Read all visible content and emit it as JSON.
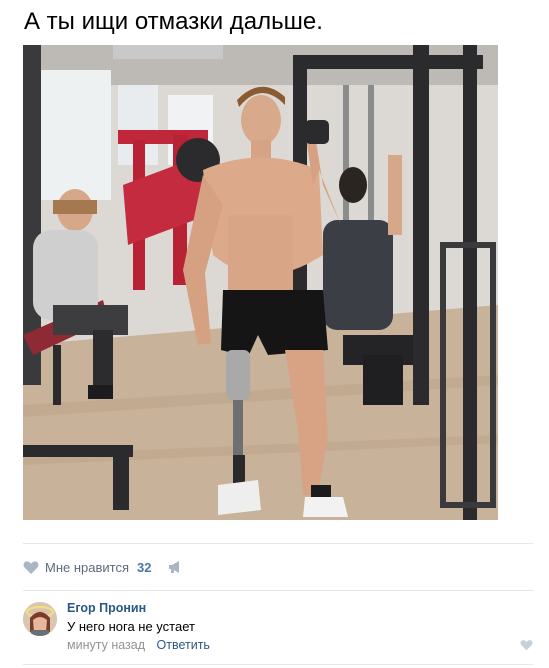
{
  "post": {
    "title": "А ты ищи отмазки дальше.",
    "photo": {
      "description_icon": "gym-photo",
      "colors": {
        "floor": "#c9b39c",
        "wall": "#e2e0dc",
        "machine": "#2b2b2e",
        "red_machine": "#c0273b",
        "skin": "#d8a88a",
        "shorts": "#151515"
      }
    }
  },
  "actions": {
    "like_label": "Мне нравится",
    "like_count": "32",
    "heart_icon": "heart-icon",
    "share_icon": "megaphone-icon",
    "icon_color": "#aab6c5"
  },
  "comment": {
    "author": "Егор Пронин",
    "text": "У него нога не устает",
    "time": "минуту назад",
    "reply_label": "Ответить",
    "avatar_icon": "avatar"
  },
  "colors": {
    "link": "#2a5885",
    "muted": "#939393",
    "divider": "#e7e8ec"
  }
}
